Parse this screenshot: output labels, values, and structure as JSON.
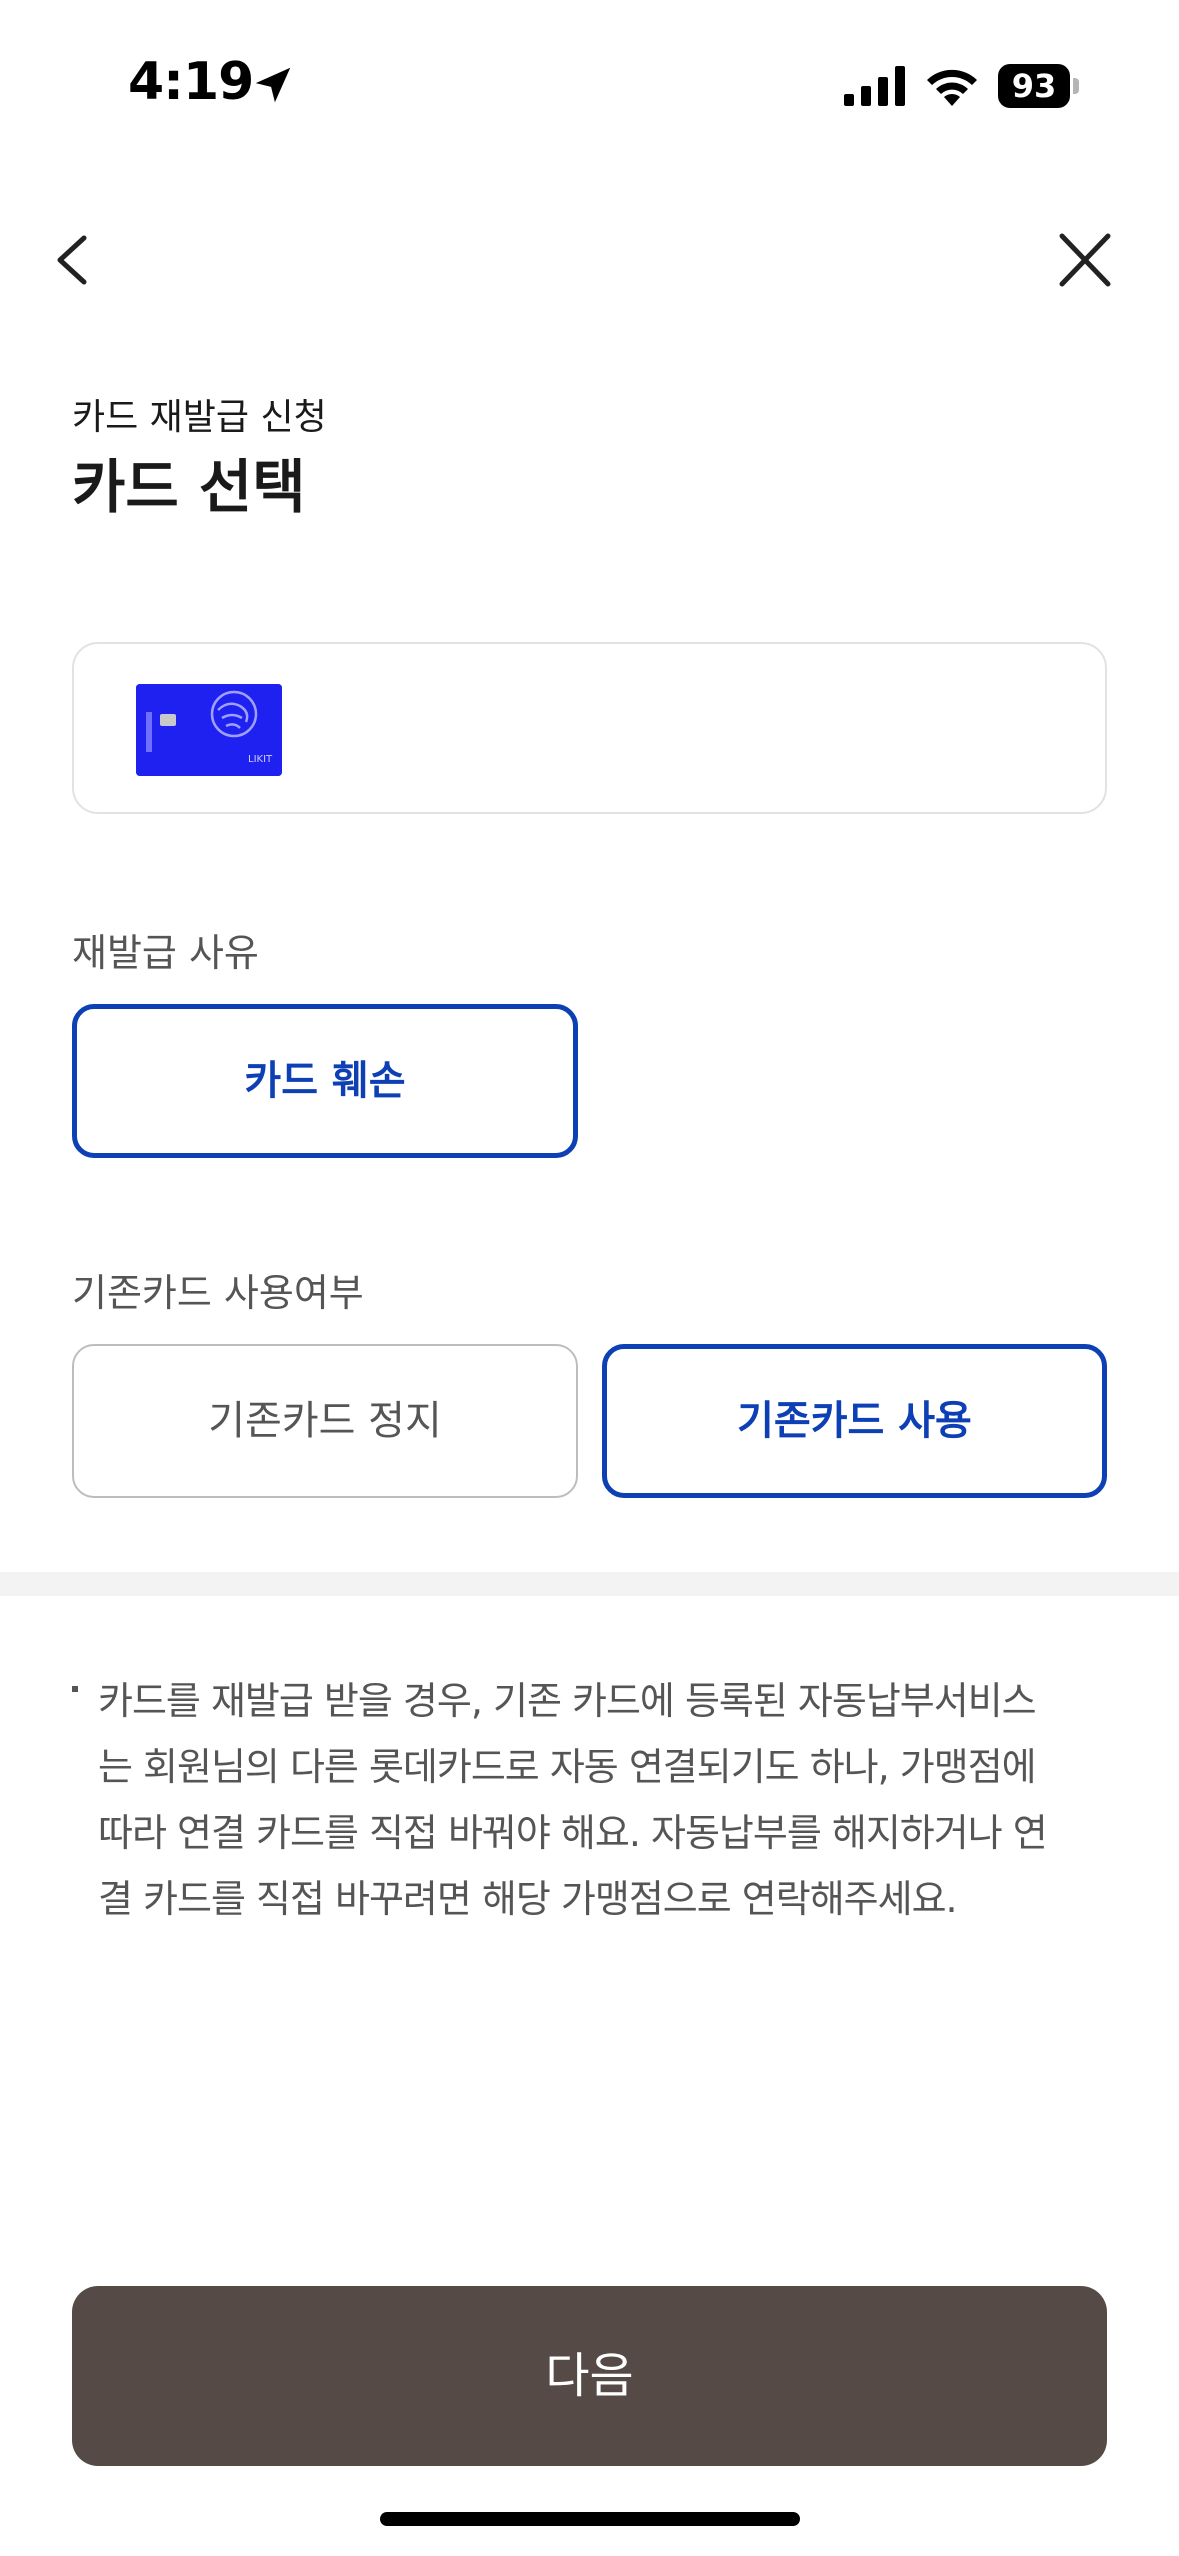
{
  "status_bar": {
    "time": "4:19",
    "battery": "93",
    "icons": [
      "location-arrow-icon",
      "signal-icon",
      "wifi-icon",
      "battery-icon"
    ]
  },
  "nav": {
    "back_icon": "chevron-left-icon",
    "close_icon": "close-icon"
  },
  "header": {
    "subtitle": "카드 재발급 신청",
    "title": "카드 선택"
  },
  "card_select": {
    "card_image": "blue-card-thumbnail",
    "card_color": "#1f21f0"
  },
  "reason_section": {
    "label": "재발급 사유",
    "options": [
      {
        "label": "카드 훼손",
        "selected": true
      }
    ]
  },
  "existing_card_section": {
    "label": "기존카드 사용여부",
    "options": [
      {
        "label": "기존카드 정지",
        "selected": false
      },
      {
        "label": "기존카드 사용",
        "selected": true
      }
    ]
  },
  "notice": {
    "lines": [
      "카드를 재발급 받을 경우, 기존 카드에 등록된 자동납부서비스",
      "는 회원님의 다른 롯데카드로 자동 연결되기도 하나, 가맹점에",
      "따라 연결 카드를 직접 바꿔야 해요. 자동납부를 해지하거나 연",
      "결 카드를 직접 바꾸려면 해당 가맹점으로 연락해주세요."
    ]
  },
  "footer": {
    "next_label": "다음"
  },
  "colors": {
    "accent": "#0d3fb5",
    "button_bg": "#564a47",
    "border_gray": "#bdbdbd",
    "divider": "#f3f3f3"
  }
}
